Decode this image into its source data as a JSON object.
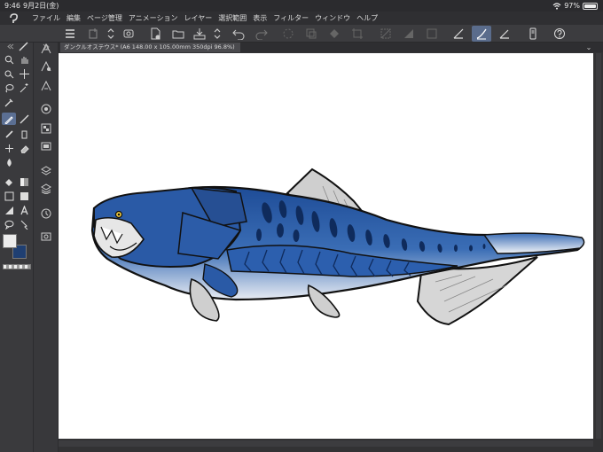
{
  "status": {
    "time": "9:46",
    "date": "9月2日(金)",
    "battery": "97%",
    "battery_level": 0.97
  },
  "menu": [
    "ファイル",
    "編集",
    "ページ管理",
    "アニメーション",
    "レイヤー",
    "選択範囲",
    "表示",
    "フィルター",
    "ウィンドウ",
    "ヘルプ"
  ],
  "document": {
    "tab_title": "ダンクルオステウス* (A6 148.00 x 105.00mm 350dpi 96.8%)"
  },
  "colors": {
    "main": "#ececec",
    "sub": "#1f3f72",
    "accent": "#5b6f93",
    "fish_blue": "#2f5fa6",
    "fish_dark": "#0f2b5c",
    "fin_gray": "#cfcfcf"
  },
  "toolbar_icons": [
    "menu-icon",
    "new-canvas-icon",
    "expand-icon",
    "frame-icon",
    "new-file-icon",
    "open-folder-icon",
    "save-icon",
    "up-down-icon",
    "undo-icon",
    "redo-icon",
    "erase-icon",
    "transform-icon",
    "fill-icon",
    "crop-icon",
    "selection-icon",
    "invert-icon",
    "deselect-icon",
    "ruler-icon",
    "brush-settings-icon",
    "snap-icon",
    "device-icon",
    "help-icon"
  ]
}
